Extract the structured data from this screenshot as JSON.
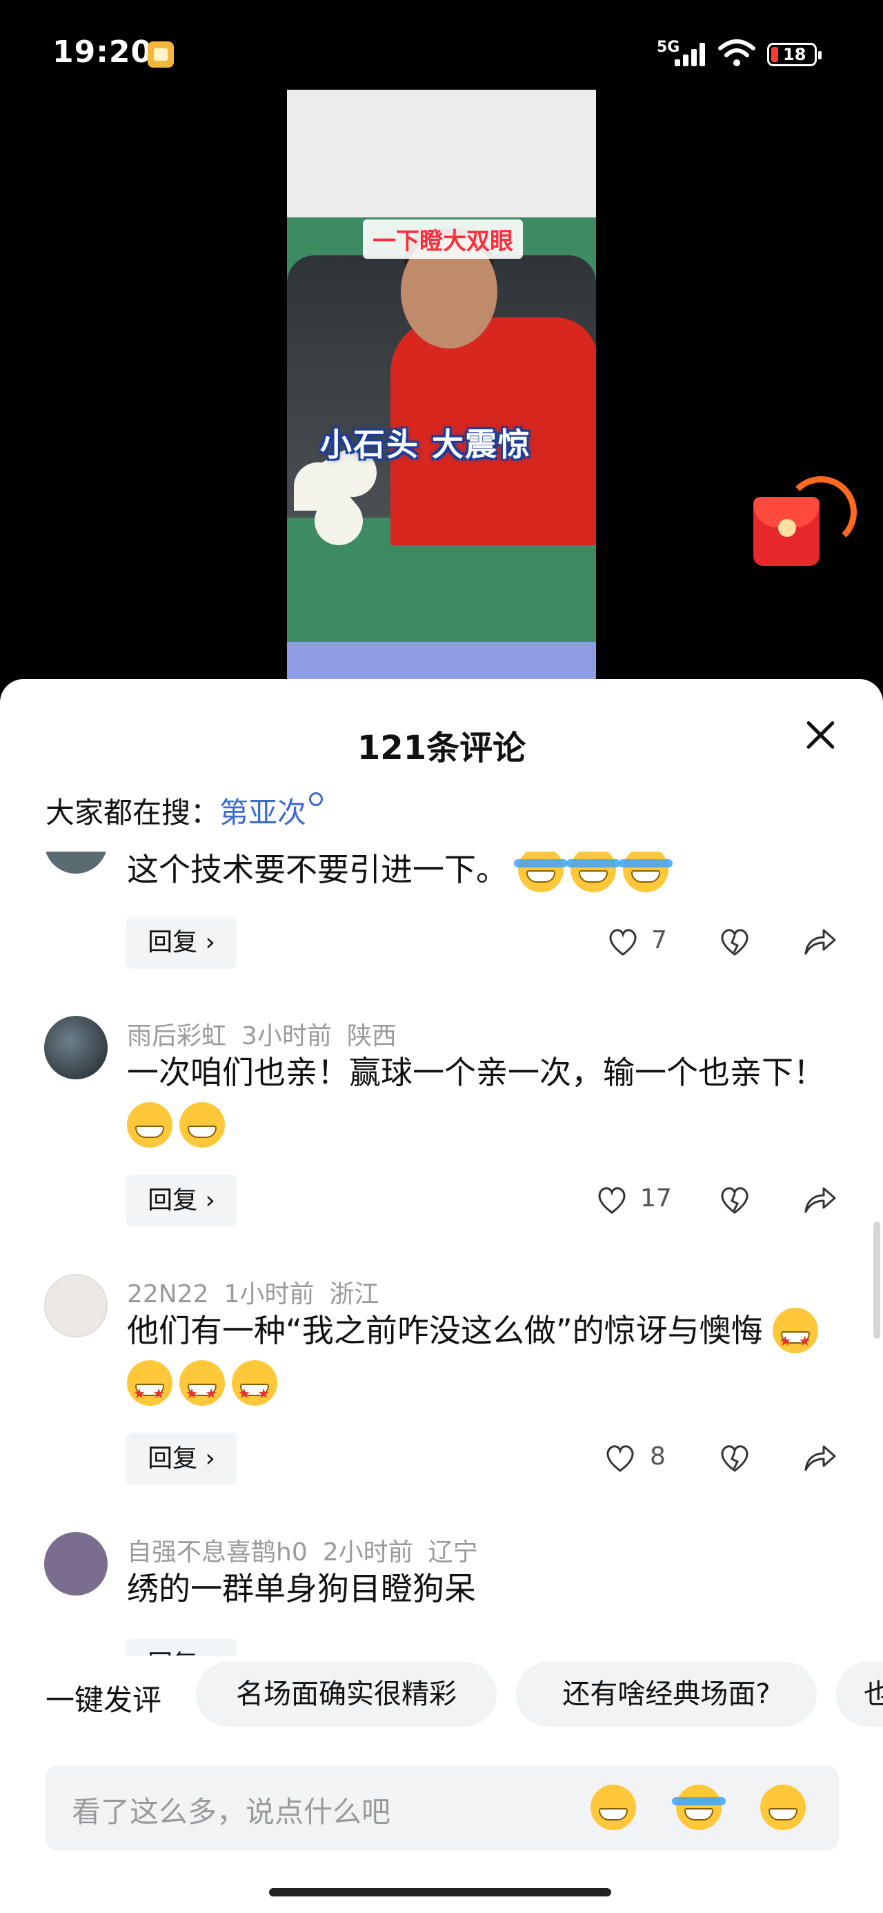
{
  "status_bar": {
    "time": "19:20",
    "network": "5G",
    "battery": "18"
  },
  "video": {
    "caption_top": "一下瞪大双眼",
    "caption_main": "小石头  大震惊",
    "watermark": ""
  },
  "sheet": {
    "title": "121条评论",
    "search_prefix": "大家都在搜：",
    "search_keyword": "第亚次"
  },
  "comments": [
    {
      "user": "",
      "time": "",
      "region": "",
      "text": "这个技术要不要引进一下。",
      "emoji": [
        "cry",
        "cry",
        "cry"
      ],
      "likes": "7",
      "reply": "回复 ›"
    },
    {
      "user": "雨后彩虹",
      "time": "3小时前",
      "region": "陕西",
      "text": "一次咱们也亲！赢球一个亲一次，输一个也亲下！",
      "emoji": [
        "grin",
        "grin"
      ],
      "likes": "17",
      "reply": "回复 ›"
    },
    {
      "user": "22N22",
      "time": "1小时前",
      "region": "浙江",
      "text": "他们有一种“我之前咋没这么做”的惊讶与懊悔",
      "emoji": [
        "star",
        "star",
        "star",
        "star"
      ],
      "likes": "8",
      "reply": "回复 ›"
    },
    {
      "user": "自强不息喜鹊h0",
      "time": "2小时前",
      "region": "辽宁",
      "text": "绣的一群单身狗目瞪狗呆",
      "emoji": [],
      "likes": "",
      "reply": "回复 ›"
    }
  ],
  "quick_comment": {
    "label": "一键发评",
    "chips": [
      "名场面确实很精彩",
      "还有啥经典场面?",
      "也"
    ]
  },
  "input": {
    "placeholder": "看了这么多，说点什么吧",
    "emojis": [
      "grin-icon",
      "laugh-cry-icon",
      "smile-icon"
    ]
  },
  "colors": {
    "accent": "#3c6bd6",
    "envelope": "#e7282a"
  }
}
